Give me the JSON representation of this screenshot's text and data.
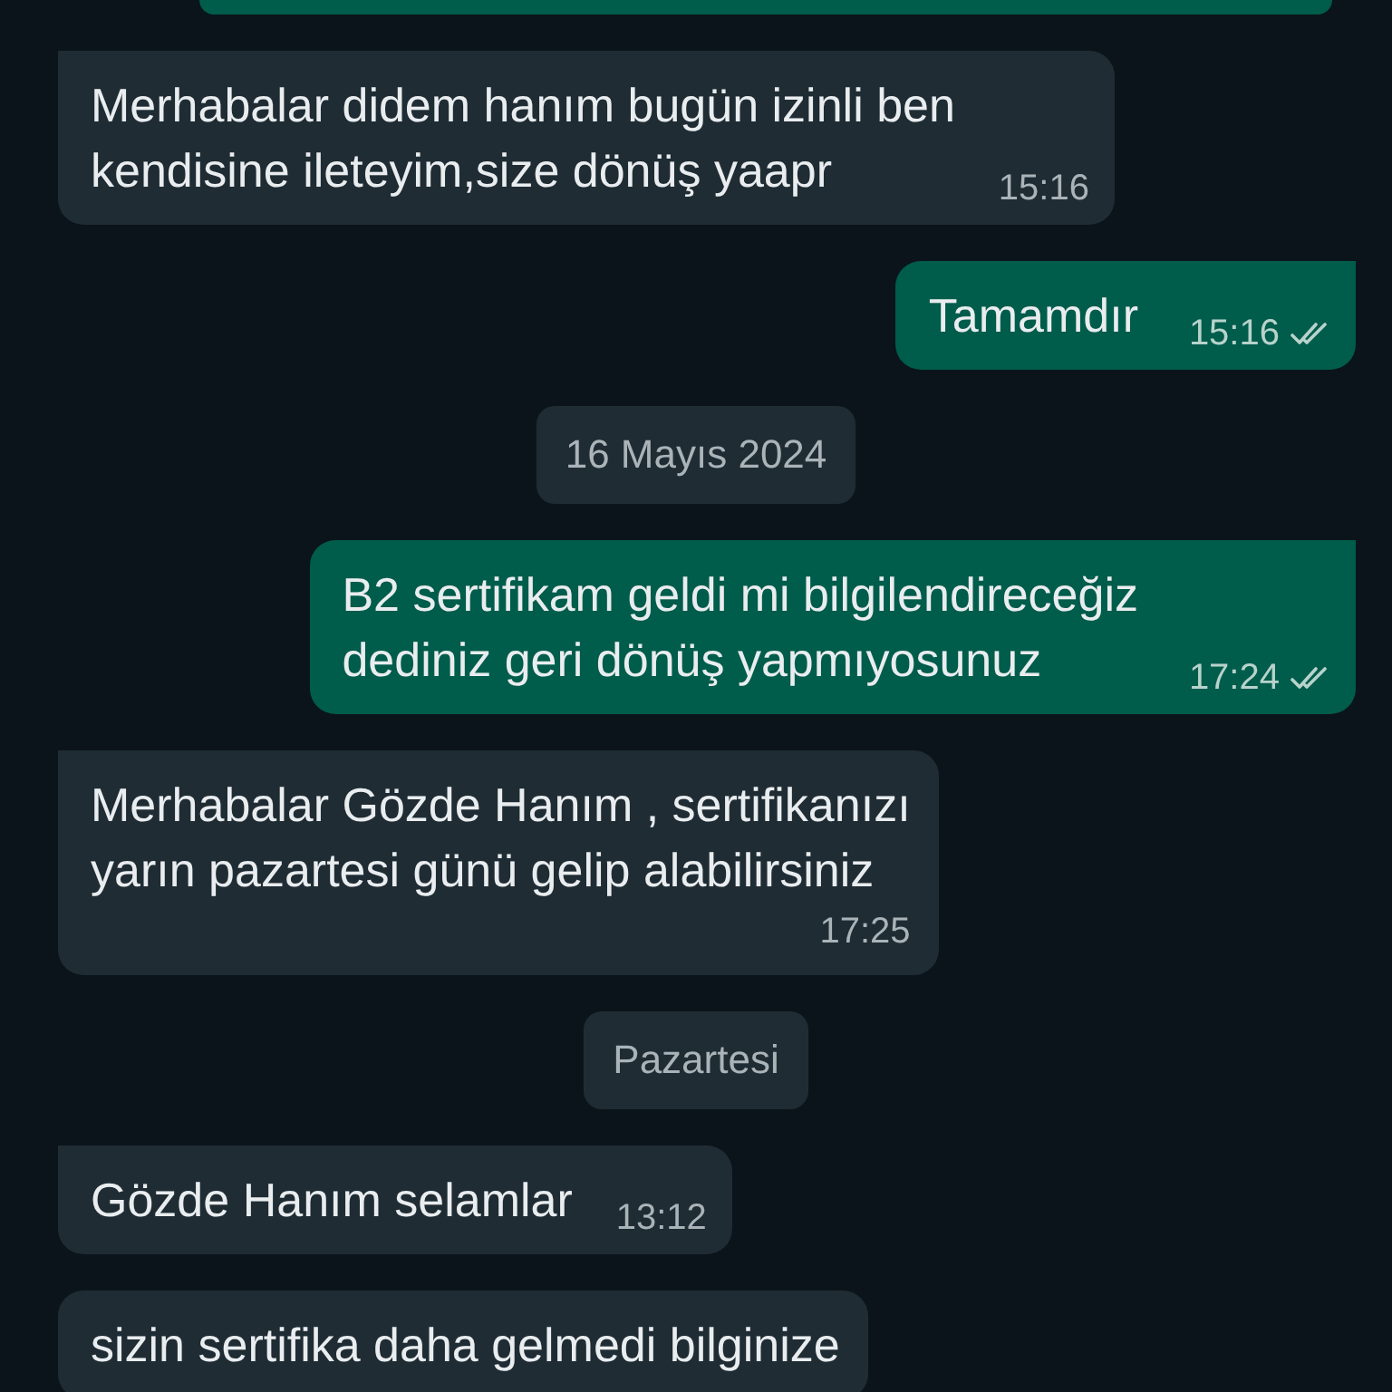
{
  "messages": [
    {
      "kind": "outgoing",
      "partial": true
    },
    {
      "kind": "incoming",
      "tail": true,
      "text": "Merhabalar didem hanım bugün izinli ben\nkendisine ileteyim,size dönüş yaapr",
      "time": "15:16"
    },
    {
      "kind": "outgoing",
      "tail": true,
      "text": "Tamamdır",
      "time": "15:16",
      "read": false
    },
    {
      "kind": "date",
      "text": "16 Mayıs 2024"
    },
    {
      "kind": "outgoing",
      "tail": true,
      "text": "B2 sertifikam geldi mi bilgilendireceğiz\ndediniz geri dönüş yapmıyosunuz",
      "time": "17:24",
      "read": false
    },
    {
      "kind": "incoming",
      "tail": true,
      "text": "Merhabalar Gözde Hanım , sertifikanızı\nyarın pazartesi günü gelip alabilirsiniz",
      "time": "17:25",
      "time_below": true
    },
    {
      "kind": "date",
      "text": "Pazartesi"
    },
    {
      "kind": "incoming",
      "tail": true,
      "text": "Gözde Hanım selamlar",
      "time": "13:12"
    },
    {
      "kind": "incoming",
      "tail": false,
      "text": "sizin sertifika daha gelmedi bilginize"
    }
  ]
}
